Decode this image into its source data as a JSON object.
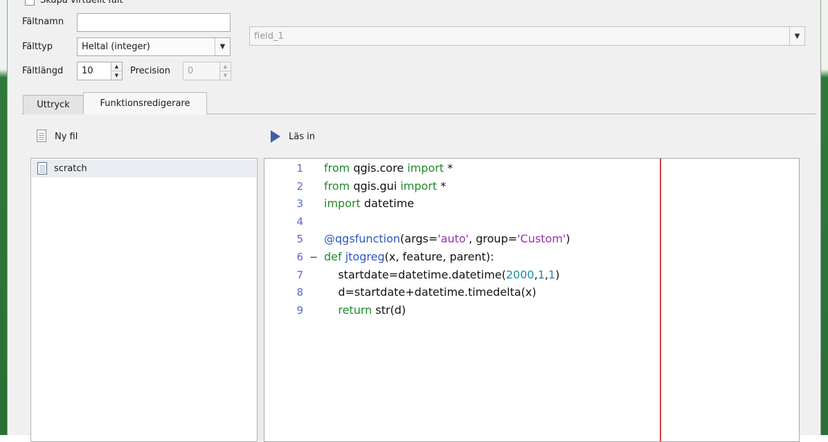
{
  "virtual_field": {
    "label": "Skapa virtuellt fält",
    "checked": false
  },
  "field_name": {
    "label": "Fältnamn",
    "value": ""
  },
  "field_type": {
    "label": "Fälttyp",
    "value": "Heltal (integer)"
  },
  "field_length": {
    "label": "Fältlängd",
    "value": "10"
  },
  "precision": {
    "label": "Precision",
    "value": "0"
  },
  "target_field": {
    "value": "field_1"
  },
  "tabs": [
    {
      "label": "Uttryck",
      "active": false
    },
    {
      "label": "Funktionsredigerare",
      "active": true
    }
  ],
  "toolbar": {
    "new_file": "Ny fil",
    "load": "Läs in"
  },
  "files": [
    "scratch"
  ],
  "editor": {
    "line_numbers": [
      "1",
      "2",
      "3",
      "4",
      "5",
      "6",
      "7",
      "8",
      "9"
    ],
    "fold_marker": "−",
    "lines": [
      [
        {
          "t": "kw",
          "v": "from"
        },
        {
          "t": "",
          "v": " qgis.core "
        },
        {
          "t": "kw",
          "v": "import"
        },
        {
          "t": "",
          "v": " *"
        }
      ],
      [
        {
          "t": "kw",
          "v": "from"
        },
        {
          "t": "",
          "v": " qgis.gui "
        },
        {
          "t": "kw",
          "v": "import"
        },
        {
          "t": "",
          "v": " *"
        }
      ],
      [
        {
          "t": "kw",
          "v": "import"
        },
        {
          "t": "",
          "v": " datetime"
        }
      ],
      [],
      [
        {
          "t": "dec",
          "v": "@qgsfunction"
        },
        {
          "t": "",
          "v": "(args="
        },
        {
          "t": "str",
          "v": "'auto'"
        },
        {
          "t": "",
          "v": ", group="
        },
        {
          "t": "str",
          "v": "'Custom'"
        },
        {
          "t": "",
          "v": ")"
        }
      ],
      [
        {
          "t": "kw",
          "v": "def"
        },
        {
          "t": "",
          "v": " "
        },
        {
          "t": "dec",
          "v": "jtogreg"
        },
        {
          "t": "",
          "v": "(x, feature, parent):"
        }
      ],
      [
        {
          "t": "",
          "v": "    startdate=datetime.datetime("
        },
        {
          "t": "num",
          "v": "2000"
        },
        {
          "t": "",
          "v": ","
        },
        {
          "t": "num",
          "v": "1"
        },
        {
          "t": "",
          "v": ","
        },
        {
          "t": "num",
          "v": "1"
        },
        {
          "t": "",
          "v": ")"
        }
      ],
      [
        {
          "t": "",
          "v": "    d=startdate+datetime.timedelta(x)"
        }
      ],
      [
        {
          "t": "",
          "v": "    "
        },
        {
          "t": "kw",
          "v": "return"
        },
        {
          "t": "",
          "v": " str(d)"
        }
      ]
    ]
  }
}
